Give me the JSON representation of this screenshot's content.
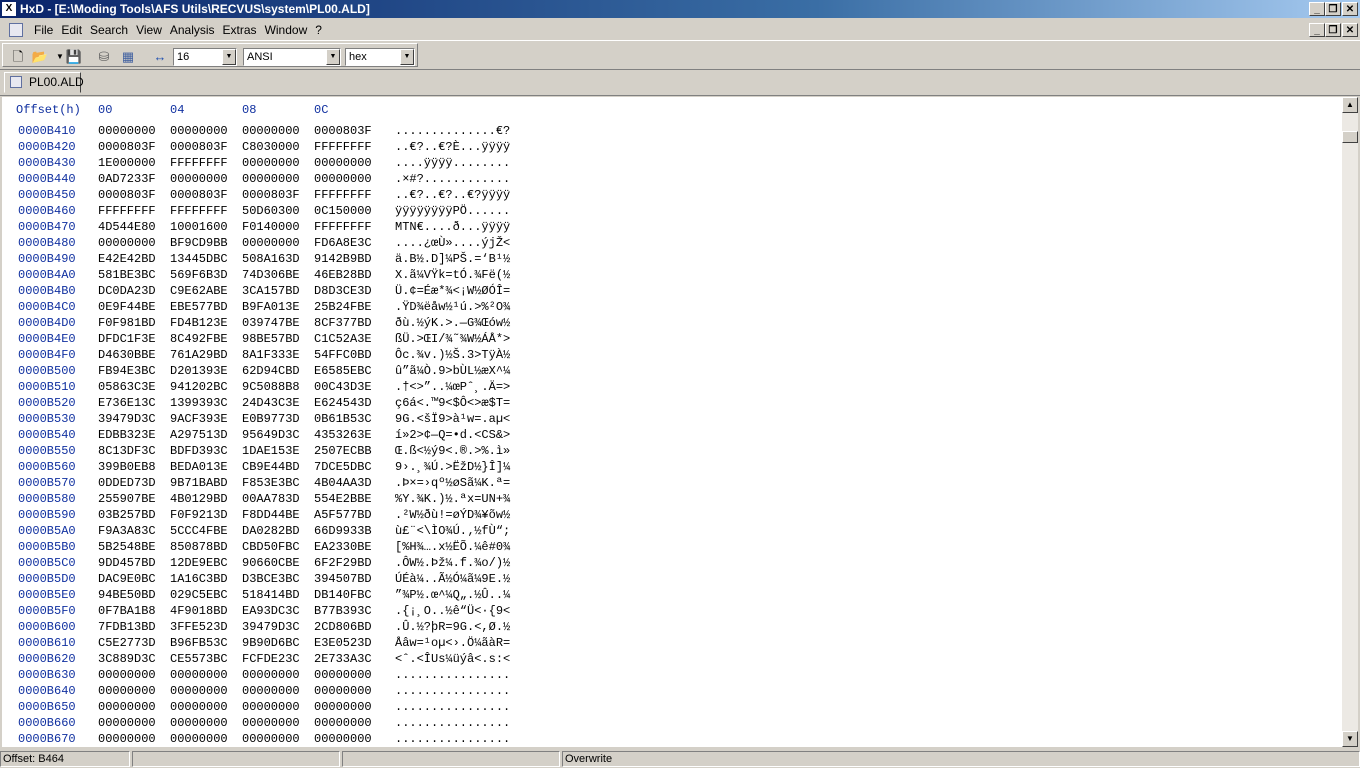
{
  "window": {
    "title": "HxD - [E:\\Moding Tools\\AFS Utils\\RECVUS\\system\\PL00.ALD]",
    "app_icon": "hxd-icon",
    "controls": [
      "minimize-icon",
      "restore-icon",
      "close-icon"
    ]
  },
  "menubar": {
    "items": [
      "File",
      "Edit",
      "Search",
      "View",
      "Analysis",
      "Extras",
      "Window",
      "?"
    ]
  },
  "toolbar": {
    "icons": [
      "new-file-icon",
      "open-file-icon",
      "save-icon",
      "open-disk-icon",
      "open-ram-icon",
      "bytes-per-row-icon"
    ],
    "bytes_per_row": "16",
    "charset": "ANSI",
    "offset_base": "hex"
  },
  "tabs": [
    {
      "label": "PL00.ALD",
      "active": true
    }
  ],
  "hex": {
    "header": {
      "offset": "Offset(h)",
      "cols": [
        "00",
        "04",
        "08",
        "0C"
      ]
    },
    "rows": [
      {
        "offset": "0000B410",
        "groups": [
          "00000000",
          "00000000",
          "00000000",
          "0000803F"
        ],
        "ascii": "..............€?"
      },
      {
        "offset": "0000B420",
        "groups": [
          "0000803F",
          "0000803F",
          "C8030000",
          "FFFFFFFF"
        ],
        "ascii": "..€?..€?È...ÿÿÿÿ"
      },
      {
        "offset": "0000B430",
        "groups": [
          "1E000000",
          "FFFFFFFF",
          "00000000",
          "00000000"
        ],
        "ascii": "....ÿÿÿÿ........"
      },
      {
        "offset": "0000B440",
        "groups": [
          "0AD7233F",
          "00000000",
          "00000000",
          "00000000"
        ],
        "ascii": ".×#?............"
      },
      {
        "offset": "0000B450",
        "groups": [
          "0000803F",
          "0000803F",
          "0000803F",
          "FFFFFFFF"
        ],
        "ascii": "..€?..€?..€?ÿÿÿÿ"
      },
      {
        "offset": "0000B460",
        "groups": [
          "FFFFFFFF",
          "FFFFFFFF",
          "50D60300",
          "0C150000"
        ],
        "ascii": "ÿÿÿÿÿÿÿÿPÖ......"
      },
      {
        "offset": "0000B470",
        "groups": [
          "4D544E80",
          "10001600",
          "F0140000",
          "FFFFFFFF"
        ],
        "ascii": "MTN€....ð...ÿÿÿÿ"
      },
      {
        "offset": "0000B480",
        "groups": [
          "00000000",
          "BF9CD9BB",
          "00000000",
          "FD6A8E3C"
        ],
        "ascii": "....¿œÙ»....ýjŽ<"
      },
      {
        "offset": "0000B490",
        "groups": [
          "E42E42BD",
          "13445DBC",
          "508A163D",
          "9142B9BD"
        ],
        "ascii": "ä.B½.D]¼PŠ.=‘B¹½"
      },
      {
        "offset": "0000B4A0",
        "groups": [
          "581BE3BC",
          "569F6B3D",
          "74D306BE",
          "46EB28BD"
        ],
        "ascii": "X.ã¼VŸk=tÓ.¾Fë(½"
      },
      {
        "offset": "0000B4B0",
        "groups": [
          "DC0DA23D",
          "C9E62ABE",
          "3CA157BD",
          "D8D3CE3D"
        ],
        "ascii": "Ü.¢=Éæ*¾<¡W½ØÓÎ="
      },
      {
        "offset": "0000B4C0",
        "groups": [
          "0E9F44BE",
          "EBE577BD",
          "B9FA013E",
          "25B24FBE"
        ],
        "ascii": ".ŸD¾ëåw½¹ú.>%²O¾"
      },
      {
        "offset": "0000B4D0",
        "groups": [
          "F0F981BD",
          "FD4B123E",
          "039747BE",
          "8CF377BD"
        ],
        "ascii": "ðù.½ýK.>.—G¾Œów½"
      },
      {
        "offset": "0000B4E0",
        "groups": [
          "DFDC1F3E",
          "8C492FBE",
          "98BE57BD",
          "C1C52A3E"
        ],
        "ascii": "ßÜ.>ŒI/¾˜¾W½ÁÅ*>"
      },
      {
        "offset": "0000B4F0",
        "groups": [
          "D4630BBE",
          "761A29BD",
          "8A1F333E",
          "54FFC0BD"
        ],
        "ascii": "Ôc.¾v.)½Š.3>TÿÀ½"
      },
      {
        "offset": "0000B500",
        "groups": [
          "FB94E3BC",
          "D201393E",
          "62D94CBD",
          "E6585EBC"
        ],
        "ascii": "û”ã¼Ò.9>bÙL½æX^¼"
      },
      {
        "offset": "0000B510",
        "groups": [
          "05863C3E",
          "941202BC",
          "9C5088B8",
          "00C43D3E"
        ],
        "ascii": ".†<>”..¼œPˆ¸.Ä=>"
      },
      {
        "offset": "0000B520",
        "groups": [
          "E736E13C",
          "1399393C",
          "24D43C3E",
          "E624543D"
        ],
        "ascii": "ç6á<.™9<$Ô<>æ$T="
      },
      {
        "offset": "0000B530",
        "groups": [
          "39479D3C",
          "9ACF393E",
          "E0B9773D",
          "0B61B53C"
        ],
        "ascii": "9G.<šÏ9>à¹w=.aµ<"
      },
      {
        "offset": "0000B540",
        "groups": [
          "EDBB323E",
          "A297513D",
          "95649D3C",
          "4353263E"
        ],
        "ascii": "í»2>¢—Q=•d.<CS&>"
      },
      {
        "offset": "0000B550",
        "groups": [
          "8C13DF3C",
          "BDFD393C",
          "1DAE153E",
          "2507ECBB"
        ],
        "ascii": "Œ.ß<½ý9<.®.>%.ì»"
      },
      {
        "offset": "0000B560",
        "groups": [
          "399B0EB8",
          "BEDA013E",
          "CB9E44BD",
          "7DCE5DBC"
        ],
        "ascii": "9›.¸¾Ú.>ËžD½}Î]¼"
      },
      {
        "offset": "0000B570",
        "groups": [
          "0DDED73D",
          "9B71BABD",
          "F853E3BC",
          "4B04AA3D"
        ],
        "ascii": ".Þ×=›qº½øSã¼K.ª="
      },
      {
        "offset": "0000B580",
        "groups": [
          "255907BE",
          "4B0129BD",
          "00AA783D",
          "554E2BBE"
        ],
        "ascii": "%Y.¾K.)½.ªx=UN+¾"
      },
      {
        "offset": "0000B590",
        "groups": [
          "03B257BD",
          "F0F9213D",
          "F8DD44BE",
          "A5F577BD"
        ],
        "ascii": ".²W½ðù!=øÝD¾¥õw½"
      },
      {
        "offset": "0000B5A0",
        "groups": [
          "F9A3A83C",
          "5CCC4FBE",
          "DA0282BD",
          "66D9933B"
        ],
        "ascii": "ù£¨<\\ÌO¾Ú.‚½fÙ“;"
      },
      {
        "offset": "0000B5B0",
        "groups": [
          "5B2548BE",
          "850878BD",
          "CBD50FBC",
          "EA2330BE"
        ],
        "ascii": "[%H¾….x½ËÕ.¼ê#0¾"
      },
      {
        "offset": "0000B5C0",
        "groups": [
          "9DD457BD",
          "12DE9EBC",
          "90660CBE",
          "6F2F29BD"
        ],
        "ascii": ".ÔW½.Þž¼.f.¾o/)½"
      },
      {
        "offset": "0000B5D0",
        "groups": [
          "DAC9E0BC",
          "1A16C3BD",
          "D3BCE3BC",
          "394507BD"
        ],
        "ascii": "ÚÉà¼..Ã½Ó¼ã¼9E.½"
      },
      {
        "offset": "0000B5E0",
        "groups": [
          "94BE50BD",
          "029C5EBC",
          "518414BD",
          "DB140FBC"
        ],
        "ascii": "”¾P½.œ^¼Q„.½Û..¼"
      },
      {
        "offset": "0000B5F0",
        "groups": [
          "0F7BA1B8",
          "4F9018BD",
          "EA93DC3C",
          "B77B393C"
        ],
        "ascii": ".{¡¸O..½ê“Ü<·{9<"
      },
      {
        "offset": "0000B600",
        "groups": [
          "7FDB13BD",
          "3FFE523D",
          "39479D3C",
          "2CD806BD"
        ],
        "ascii": ".Û.½?þR=9G.<,Ø.½"
      },
      {
        "offset": "0000B610",
        "groups": [
          "C5E2773D",
          "B96FB53C",
          "9B90D6BC",
          "E3E0523D"
        ],
        "ascii": "Åâw=¹oµ<›.Ö¼ãàR="
      },
      {
        "offset": "0000B620",
        "groups": [
          "3C889D3C",
          "CE5573BC",
          "FCFDE23C",
          "2E733A3C"
        ],
        "ascii": "<ˆ.<ÎUs¼üýâ<.s:<"
      },
      {
        "offset": "0000B630",
        "groups": [
          "00000000",
          "00000000",
          "00000000",
          "00000000"
        ],
        "ascii": "................"
      },
      {
        "offset": "0000B640",
        "groups": [
          "00000000",
          "00000000",
          "00000000",
          "00000000"
        ],
        "ascii": "................"
      },
      {
        "offset": "0000B650",
        "groups": [
          "00000000",
          "00000000",
          "00000000",
          "00000000"
        ],
        "ascii": "................"
      },
      {
        "offset": "0000B660",
        "groups": [
          "00000000",
          "00000000",
          "00000000",
          "00000000"
        ],
        "ascii": "................"
      },
      {
        "offset": "0000B670",
        "groups": [
          "00000000",
          "00000000",
          "00000000",
          "00000000"
        ],
        "ascii": "................"
      }
    ]
  },
  "statusbar": {
    "offset": "Offset: B464",
    "mode": "Overwrite"
  }
}
